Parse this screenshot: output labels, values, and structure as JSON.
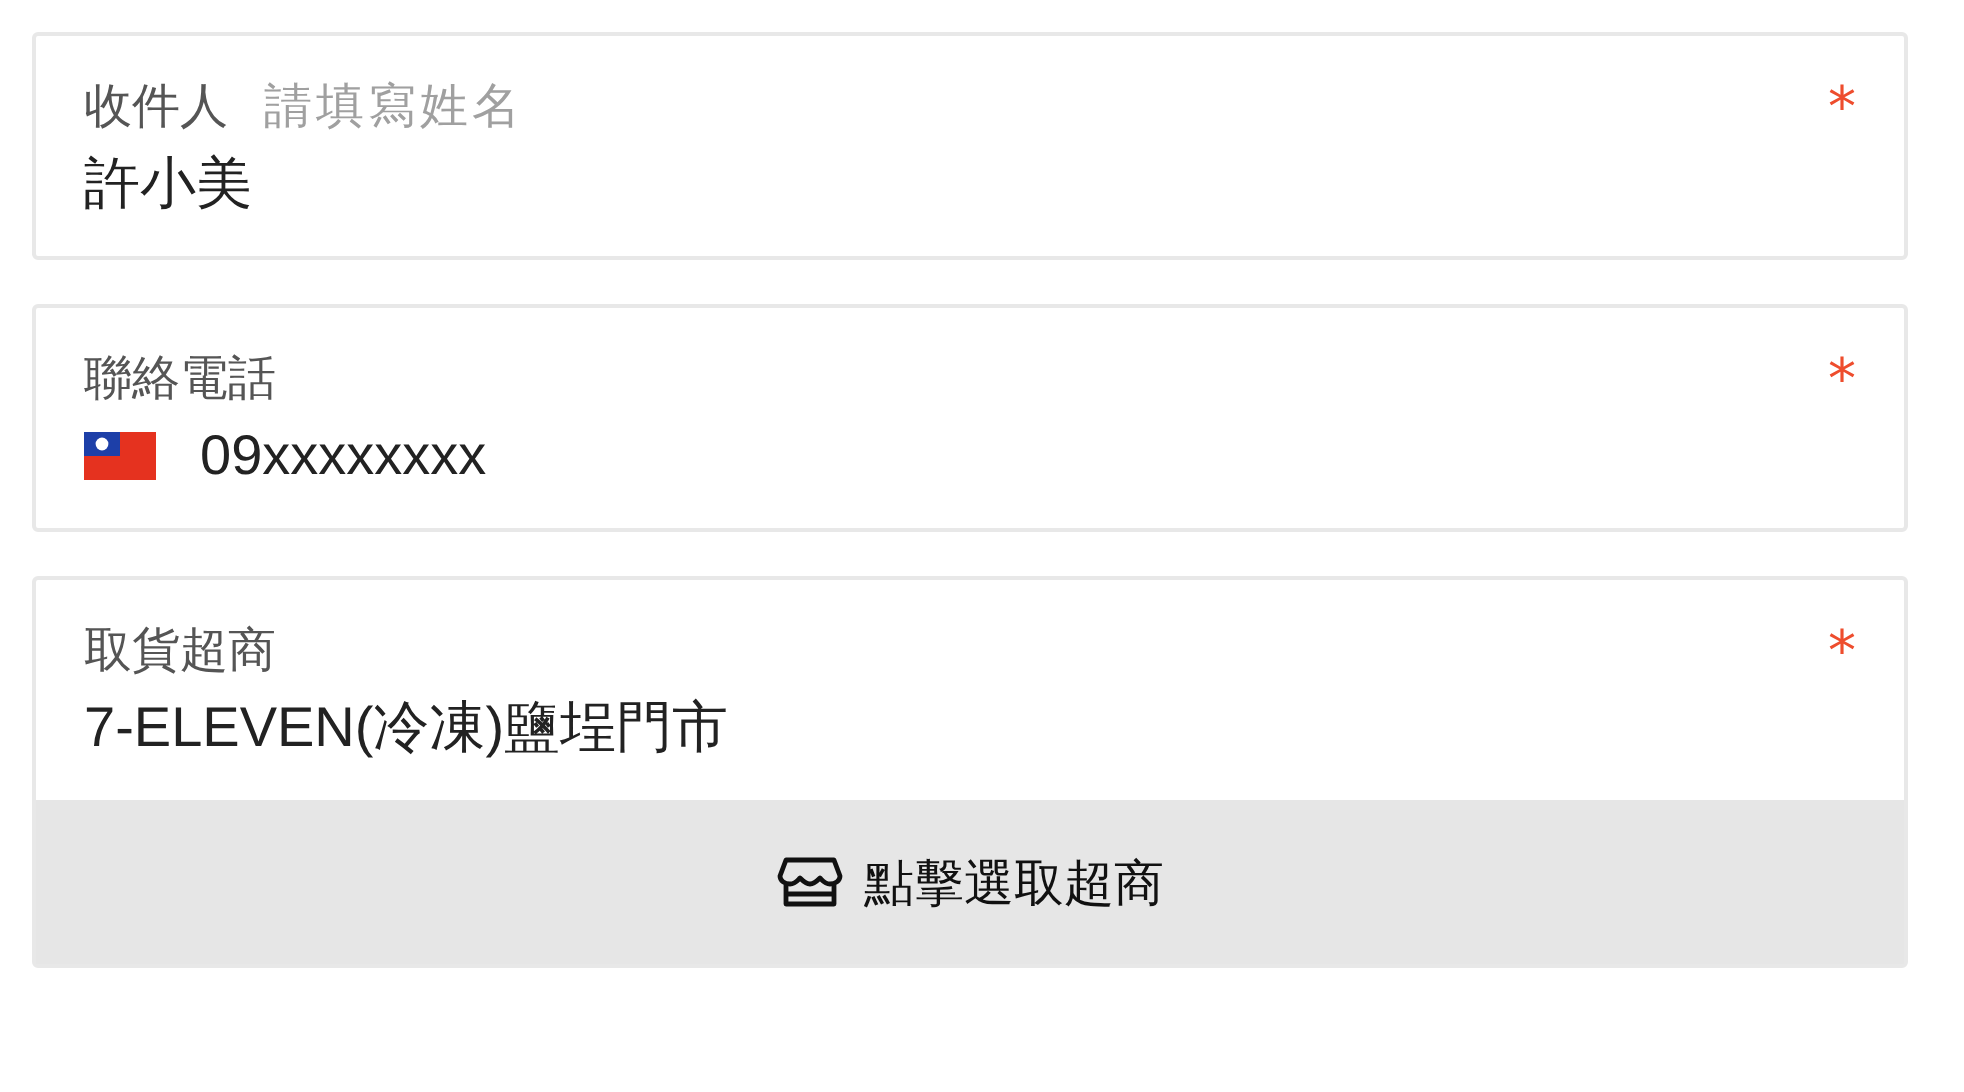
{
  "fields": [
    {
      "kind": "text",
      "label": "收件人",
      "hint": "請填寫姓名",
      "value": "許小美",
      "required_mark": "*"
    },
    {
      "kind": "phone",
      "label": "聯絡電話",
      "value": "09xxxxxxxx",
      "required_mark": "*"
    },
    {
      "kind": "store",
      "label": "取貨超商",
      "value": "7-ELEVEN(冷凍)鹽埕門市",
      "required_mark": "*",
      "button": "點擊選取超商"
    }
  ]
}
